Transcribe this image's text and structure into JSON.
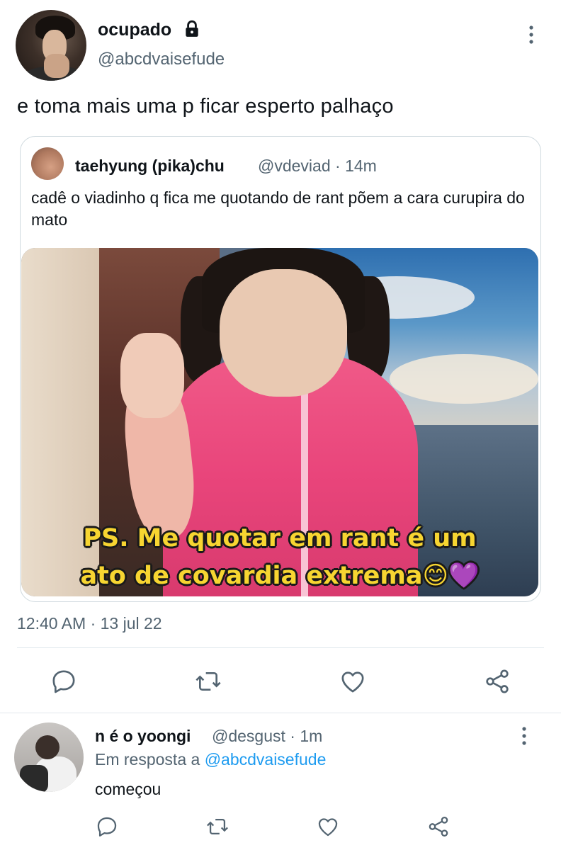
{
  "main_tweet": {
    "display_name": "ocupado",
    "handle": "@abcdvaisefude",
    "text": "e toma mais uma p ficar esperto palhaço",
    "timestamp": "12:40 AM · 13 jul 22",
    "icons": {
      "lock": "lock-icon",
      "more": "more-vertical-icon"
    }
  },
  "quoted_tweet": {
    "display_name": "taehyung (pika)chu",
    "meta": "@vdeviad · 14m",
    "text": "cadê o viadinho q fica me quotando de rant põem a cara curupira do mato",
    "image_caption_line1": "PS. Me quotar em rant é um",
    "image_caption_line2": "ato de covardia extrema😊💜"
  },
  "actions": {
    "icons": [
      "reply-icon",
      "retweet-icon",
      "like-icon",
      "share-icon"
    ],
    "accent_color": "#536471"
  },
  "reply": {
    "display_name": "n é o yoongi",
    "meta": "@desgust · 1m",
    "replying_prefix": "Em resposta a",
    "replying_to": "@abcdvaisefude",
    "text": "começou",
    "link_color": "#1d9bf0"
  }
}
